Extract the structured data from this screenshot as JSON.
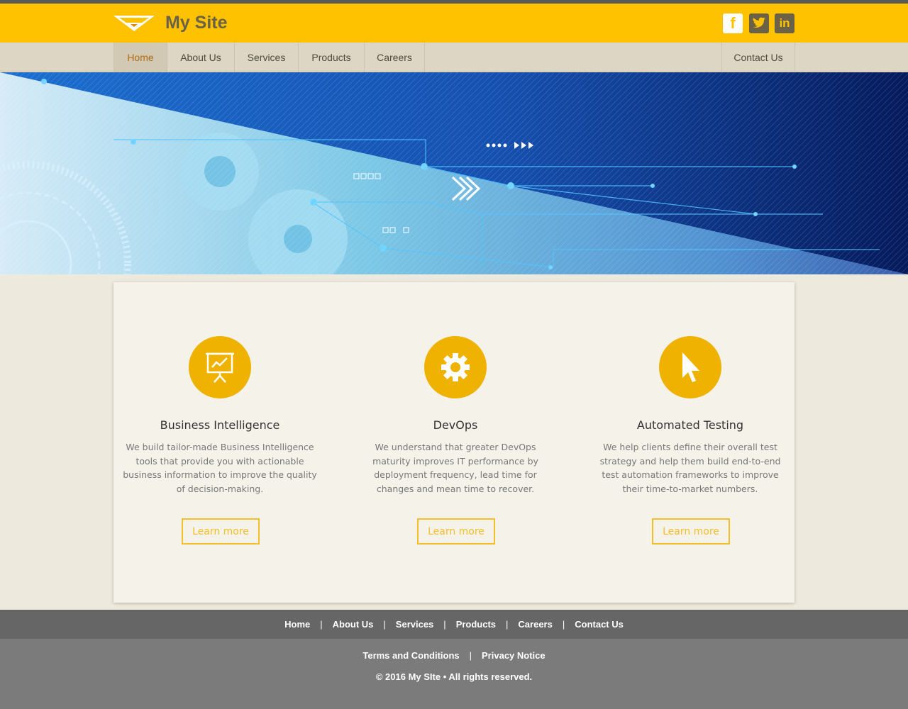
{
  "header": {
    "site_title": "My Site",
    "social": [
      {
        "name": "facebook",
        "label": "f"
      },
      {
        "name": "twitter",
        "label": "t"
      },
      {
        "name": "linkedin",
        "label": "in"
      }
    ]
  },
  "nav": {
    "items": [
      "Home",
      "About Us",
      "Services",
      "Products",
      "Careers"
    ],
    "contact": "Contact Us",
    "active": "Home"
  },
  "features": [
    {
      "icon": "presentation-chart-icon",
      "title": "Business Intelligence",
      "text": "We build tailor-made Business Intelligence tools that provide you with actionable business information to improve the quality of decision-making.",
      "button": "Learn more"
    },
    {
      "icon": "gear-icon",
      "title": "DevOps",
      "text": "We understand that greater DevOps maturity improves IT performance by deployment frequency, lead time for changes and mean time to recover.",
      "button": "Learn more"
    },
    {
      "icon": "cursor-icon",
      "title": "Automated Testing",
      "text": "We help clients define their overall test strategy and help them build end-to-end test automation frameworks to improve their time-to-market numbers.",
      "button": "Learn more"
    }
  ],
  "footer": {
    "nav": [
      "Home",
      "About Us",
      "Services",
      "Products",
      "Careers",
      "Contact Us"
    ],
    "legal": [
      "Terms and Conditions",
      "Privacy Notice"
    ],
    "copyright": "© 2016 My SIte • All rights reserved."
  },
  "colors": {
    "header": "#ffc200",
    "accent": "#efb200",
    "nav": "#ddd6c4",
    "footer_nav": "#666666",
    "footer_bottom": "#7b7b7b"
  }
}
